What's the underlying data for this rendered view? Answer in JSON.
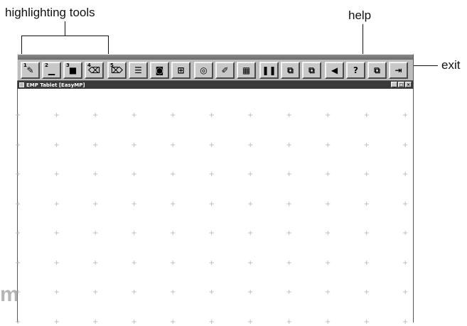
{
  "callouts": {
    "highlighting_tools": "highlighting tools",
    "help": "help",
    "exit": "exit"
  },
  "toolbar": {
    "buttons": [
      {
        "name": "highlight-tool-1-button",
        "icon": "pen-icon",
        "num": "1",
        "glyph": "✎"
      },
      {
        "name": "highlight-tool-2-button",
        "icon": "line-icon",
        "num": "2",
        "glyph": "▁"
      },
      {
        "name": "highlight-tool-3-button",
        "icon": "box-icon",
        "num": "3",
        "glyph": "■"
      },
      {
        "name": "highlight-tool-4-button",
        "icon": "eraser-icon",
        "num": "4",
        "glyph": "⌫"
      },
      {
        "name": "highlight-tool-5-button",
        "icon": "eraser-all-icon",
        "num": "5",
        "glyph": "⌦"
      },
      {
        "name": "list-button",
        "icon": "list-icon",
        "num": "",
        "glyph": "☰"
      },
      {
        "name": "camera-button",
        "icon": "camera-icon",
        "num": "",
        "glyph": "◙"
      },
      {
        "name": "capture-button",
        "icon": "capture-icon",
        "num": "",
        "glyph": "⊞"
      },
      {
        "name": "disc-button",
        "icon": "disc-icon",
        "num": "",
        "glyph": "◎"
      },
      {
        "name": "pen-settings-button",
        "icon": "pencil-icon",
        "num": "",
        "glyph": "✐"
      },
      {
        "name": "effects-button",
        "icon": "effects-icon",
        "num": "",
        "glyph": "▦"
      },
      {
        "name": "pause-button",
        "icon": "pause-icon",
        "num": "",
        "glyph": "❚❚"
      },
      {
        "name": "window-tile-button",
        "icon": "window-tile-icon",
        "num": "",
        "glyph": "⧉"
      },
      {
        "name": "window-stack-button",
        "icon": "window-stack-icon",
        "num": "",
        "glyph": "⧉"
      },
      {
        "name": "back-button",
        "icon": "arrow-left-icon",
        "num": "",
        "glyph": "◀"
      },
      {
        "name": "help-button",
        "icon": "help-icon",
        "num": "",
        "glyph": "?"
      },
      {
        "name": "window-switch-button",
        "icon": "window-switch-icon",
        "num": "",
        "glyph": "⧉"
      },
      {
        "name": "exit-button",
        "icon": "exit-icon",
        "num": "",
        "glyph": "⇥"
      }
    ]
  },
  "window": {
    "title": "EMP Tablet [EasyMP]",
    "controls": {
      "minimize": "_",
      "maximize": "□",
      "close": "×"
    }
  },
  "watermark": "m"
}
